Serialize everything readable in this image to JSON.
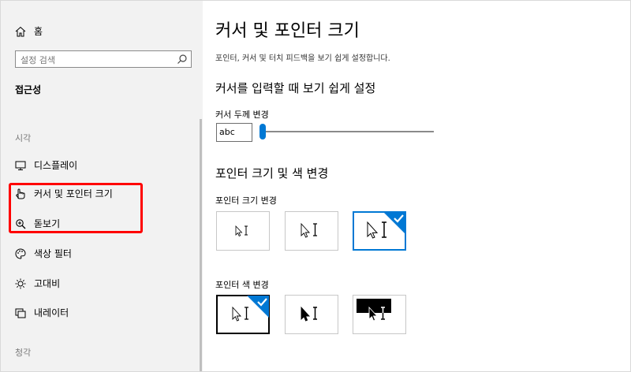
{
  "sidebar": {
    "home_label": "홈",
    "search_placeholder": "설정 검색",
    "category_title": "접근성",
    "groups": {
      "vision": "시각",
      "hearing": "청각"
    },
    "items": [
      {
        "label": "디스플레이",
        "icon": "display-icon"
      },
      {
        "label": "커서 및 포인터 크기",
        "icon": "cursor-hand-icon"
      },
      {
        "label": "돋보기",
        "icon": "magnifier-icon"
      },
      {
        "label": "색상 필터",
        "icon": "palette-icon"
      },
      {
        "label": "고대비",
        "icon": "brightness-icon"
      },
      {
        "label": "내레이터",
        "icon": "narrator-icon"
      }
    ],
    "highlight_color": "#ff0000"
  },
  "main": {
    "title": "커서 및 포인터 크기",
    "description": "포인터, 커서 및 터치 피드백을 보기 쉽게 설정합니다.",
    "cursor_section": {
      "heading": "커서를 입력할 때 보기 쉽게 설정",
      "thickness_label": "커서 두께 변경",
      "preview_text": "abc",
      "thickness_value": 1
    },
    "pointer_section": {
      "heading": "포인터 크기 및 색 변경",
      "size_label": "포인터 크기 변경",
      "size_options": [
        {
          "name": "small",
          "selected": false
        },
        {
          "name": "medium",
          "selected": false
        },
        {
          "name": "large",
          "selected": true
        }
      ],
      "color_label": "포인터 색 변경",
      "color_options": [
        {
          "name": "white",
          "selected": true
        },
        {
          "name": "black",
          "selected": false
        },
        {
          "name": "inverted",
          "selected": false
        }
      ]
    },
    "accent_color": "#0078d4"
  }
}
